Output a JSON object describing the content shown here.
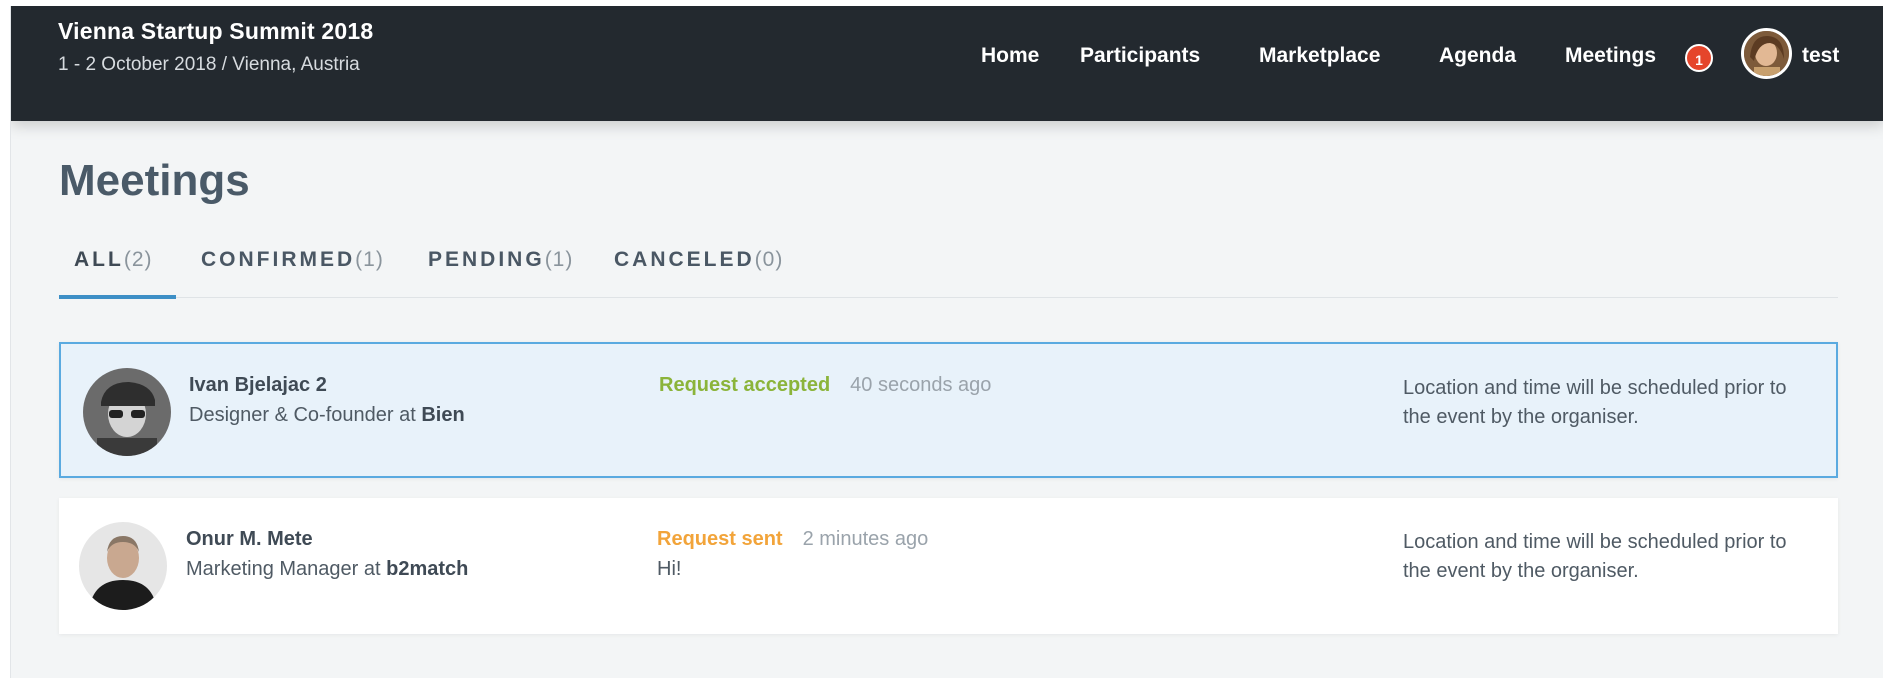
{
  "event": {
    "title": "Vienna Startup Summit 2018",
    "subtitle": "1 - 2 October 2018 / Vienna, Austria"
  },
  "nav": {
    "home": "Home",
    "participants": "Participants",
    "marketplace": "Marketplace",
    "agenda": "Agenda",
    "meetings": "Meetings",
    "meetings_badge": "1",
    "user": "test"
  },
  "page": {
    "title": "Meetings",
    "tabs": [
      {
        "label": "ALL",
        "count": "(2)"
      },
      {
        "label": "CONFIRMED",
        "count": "(1)"
      },
      {
        "label": "PENDING",
        "count": "(1)"
      },
      {
        "label": "CANCELED",
        "count": "(0)"
      }
    ]
  },
  "meetings": [
    {
      "name": "Ivan Bjelajac 2",
      "role": "Designer & Co-founder at ",
      "company": "Bien",
      "status": "Request accepted",
      "status_color": "#8bb43a",
      "time": "40 seconds ago",
      "message": "",
      "location": "Location and time will be scheduled prior to the event by the organiser."
    },
    {
      "name": "Onur M. Mete",
      "role": "Marketing Manager at ",
      "company": "b2match",
      "status": "Request sent",
      "status_color": "#f2a43a",
      "time": "2 minutes ago",
      "message": "Hi!",
      "location": "Location and time will be scheduled prior to the event by the organiser."
    }
  ]
}
